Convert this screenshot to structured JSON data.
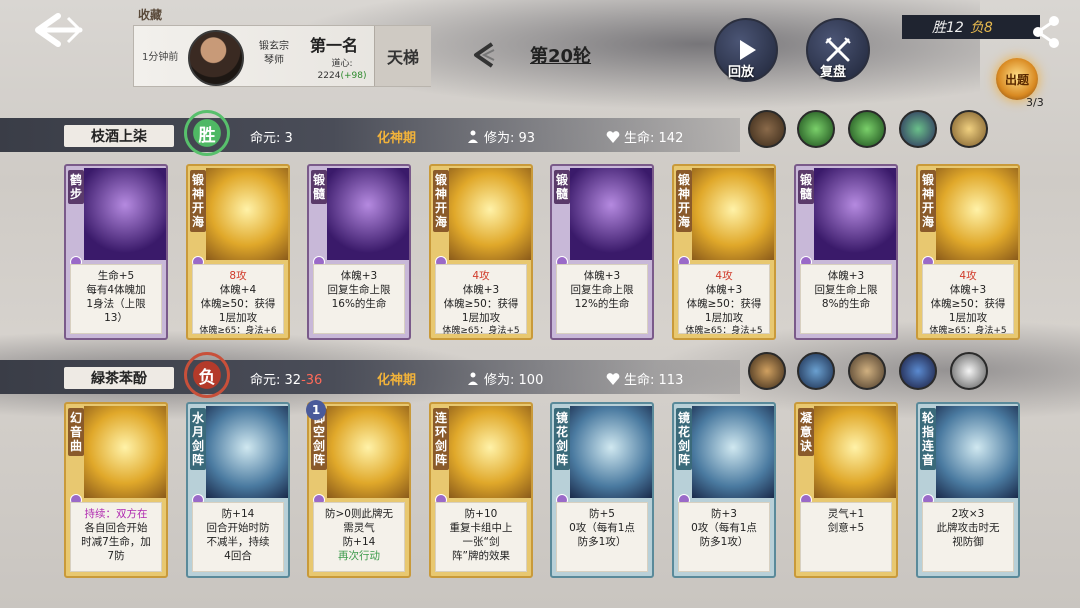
{
  "header": {
    "favorite_label": "收藏",
    "time_ago": "1分钟前",
    "sect": "锻玄宗",
    "sect_role": "琴师",
    "rank": "第一名",
    "heart_label": "道心:",
    "heart_value": "2224",
    "heart_delta": "(+98)",
    "mode": "天梯",
    "round": "第20轮",
    "replay_label": "回放",
    "review_label": "复盘",
    "wins": "胜12",
    "losses": "负8",
    "lantern_label": "出题",
    "lantern_count": "3/3"
  },
  "player1": {
    "name": "枝酒上柒",
    "result": "胜",
    "destiny_label": "命元:",
    "destiny": "3",
    "realm": "化神期",
    "cultivation_label": "修为:",
    "cultivation": "93",
    "hp_label": "生命:",
    "hp": "142",
    "cards": [
      {
        "title": "鹤步",
        "style": "purple",
        "lines": [
          "生命+5",
          "每有4体魄加",
          "1身法（上限",
          "13）"
        ]
      },
      {
        "title": "锻神开海",
        "style": "gold",
        "lines": [
          "8攻",
          "体魄+4",
          "体魄≥50：获得",
          "1层加攻",
          "体魄≥65：身法+6"
        ]
      },
      {
        "title": "锻髓",
        "style": "purple",
        "lines": [
          "体魄+3",
          "回复生命上限",
          "16%的生命"
        ]
      },
      {
        "title": "锻神开海",
        "style": "gold",
        "lines": [
          "4攻",
          "体魄+3",
          "体魄≥50：获得",
          "1层加攻",
          "体魄≥65：身法+5"
        ]
      },
      {
        "title": "锻髓",
        "style": "purple",
        "lines": [
          "体魄+3",
          "回复生命上限",
          "12%的生命"
        ]
      },
      {
        "title": "锻神开海",
        "style": "gold",
        "lines": [
          "4攻",
          "体魄+3",
          "体魄≥50：获得",
          "1层加攻",
          "体魄≥65：身法+5"
        ]
      },
      {
        "title": "锻髓",
        "style": "purple",
        "lines": [
          "体魄+3",
          "回复生命上限",
          "8%的生命"
        ]
      },
      {
        "title": "锻神开海",
        "style": "gold",
        "lines": [
          "4攻",
          "体魄+3",
          "体魄≥50：获得",
          "1层加攻",
          "体魄≥65：身法+5"
        ]
      }
    ]
  },
  "player2": {
    "name": "緑茶苯酚",
    "result": "负",
    "destiny_label": "命元:",
    "destiny": "32",
    "destiny_sep": "-",
    "destiny_loss": "36",
    "realm": "化神期",
    "cultivation_label": "修为:",
    "cultivation": "100",
    "hp_label": "生命:",
    "hp": "113",
    "level_badge": "1",
    "cards": [
      {
        "title": "幻音曲",
        "style": "gold",
        "lines": [
          "持续：双方在",
          "各自回合开始",
          "时减7生命，加",
          "7防"
        ]
      },
      {
        "title": "水月剑阵",
        "style": "teal",
        "lines": [
          "防+14",
          "回合开始时防",
          "不减半，持续",
          "4回合"
        ]
      },
      {
        "title": "御空剑阵",
        "style": "gold",
        "lines": [
          "防>0则此牌无",
          "需灵气",
          "防+14",
          "再次行动"
        ]
      },
      {
        "title": "连环剑阵",
        "style": "gold",
        "lines": [
          "防+10",
          "重复卡组中上",
          "一张“剑",
          "阵”牌的效果"
        ]
      },
      {
        "title": "镜花剑阵",
        "style": "teal",
        "lines": [
          "防+5",
          "0攻（每有1点",
          "防多1攻）"
        ]
      },
      {
        "title": "镜花剑阵",
        "style": "teal",
        "lines": [
          "防+3",
          "0攻（每有1点",
          "防多1攻）"
        ]
      },
      {
        "title": "凝意诀",
        "style": "gold",
        "lines": [
          "灵气+1",
          "剑意+5"
        ]
      },
      {
        "title": "轮指连音",
        "style": "teal",
        "lines": [
          "2攻×3",
          "此牌攻击时无",
          "视防御"
        ]
      }
    ]
  },
  "colors": {
    "win": "#4fb864",
    "lose": "#c8503a",
    "realm": "#f2b33a",
    "accent_red": "#d03a2a"
  }
}
